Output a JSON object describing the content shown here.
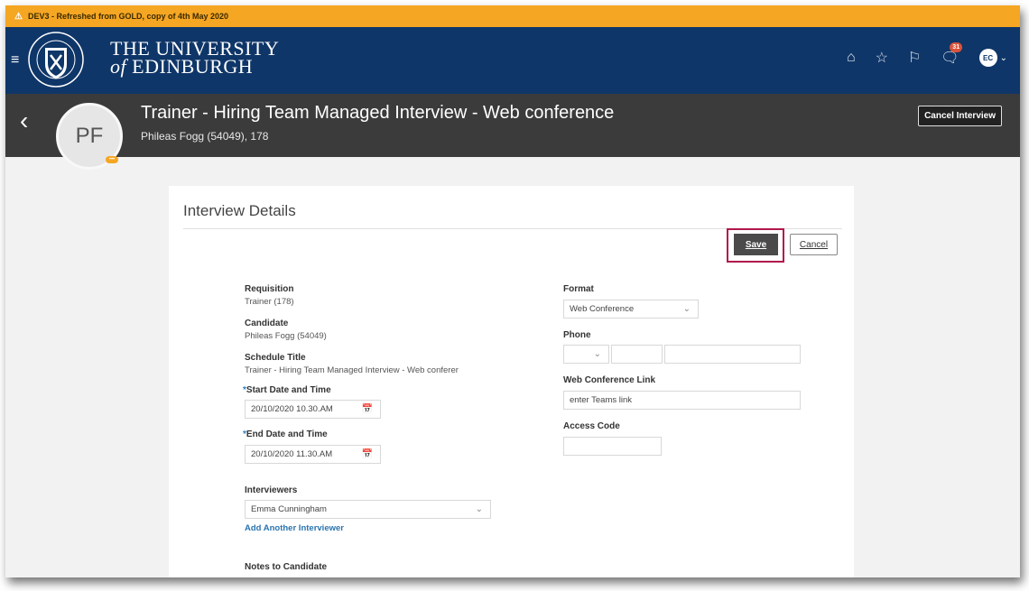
{
  "env_banner": "DEV3 - Refreshed from GOLD, copy of 4th May 2020",
  "brand": {
    "line1": "THE UNIVERSITY",
    "line2_of": "of",
    "line2": "EDINBURGH"
  },
  "nav": {
    "notifications_count": "31",
    "user_initials": "EC"
  },
  "header": {
    "avatar_initials": "PF",
    "title": "Trainer - Hiring Team Managed Interview - Web conference",
    "subtitle": "Phileas Fogg (54049), 178",
    "cancel_interview": "Cancel Interview"
  },
  "card": {
    "title": "Interview Details",
    "save": "Save",
    "cancel": "Cancel",
    "left": {
      "requisition_label": "Requisition",
      "requisition_value": "Trainer (178)",
      "candidate_label": "Candidate",
      "candidate_value": "Phileas Fogg (54049)",
      "schedule_title_label": "Schedule Title",
      "schedule_title_value": "Trainer - Hiring Team Managed Interview - Web conferer",
      "start_label": "Start Date and Time",
      "start_value": "20/10/2020 10.30.AM",
      "end_label": "End Date and Time",
      "end_value": "20/10/2020 11.30.AM",
      "interviewers_label": "Interviewers",
      "interviewers_value": "Emma Cunningham",
      "add_interviewer": "Add Another Interviewer",
      "notes_label": "Notes to Candidate"
    },
    "right": {
      "format_label": "Format",
      "format_value": "Web Conference",
      "phone_label": "Phone",
      "web_link_label": "Web Conference Link",
      "web_link_value": "enter Teams link",
      "access_code_label": "Access Code"
    }
  },
  "colors": {
    "env_bar": "#f5a623",
    "nav": "#0f3668",
    "header": "#3b3b3b",
    "highlight": "#b0174a",
    "link": "#2a74b0"
  }
}
